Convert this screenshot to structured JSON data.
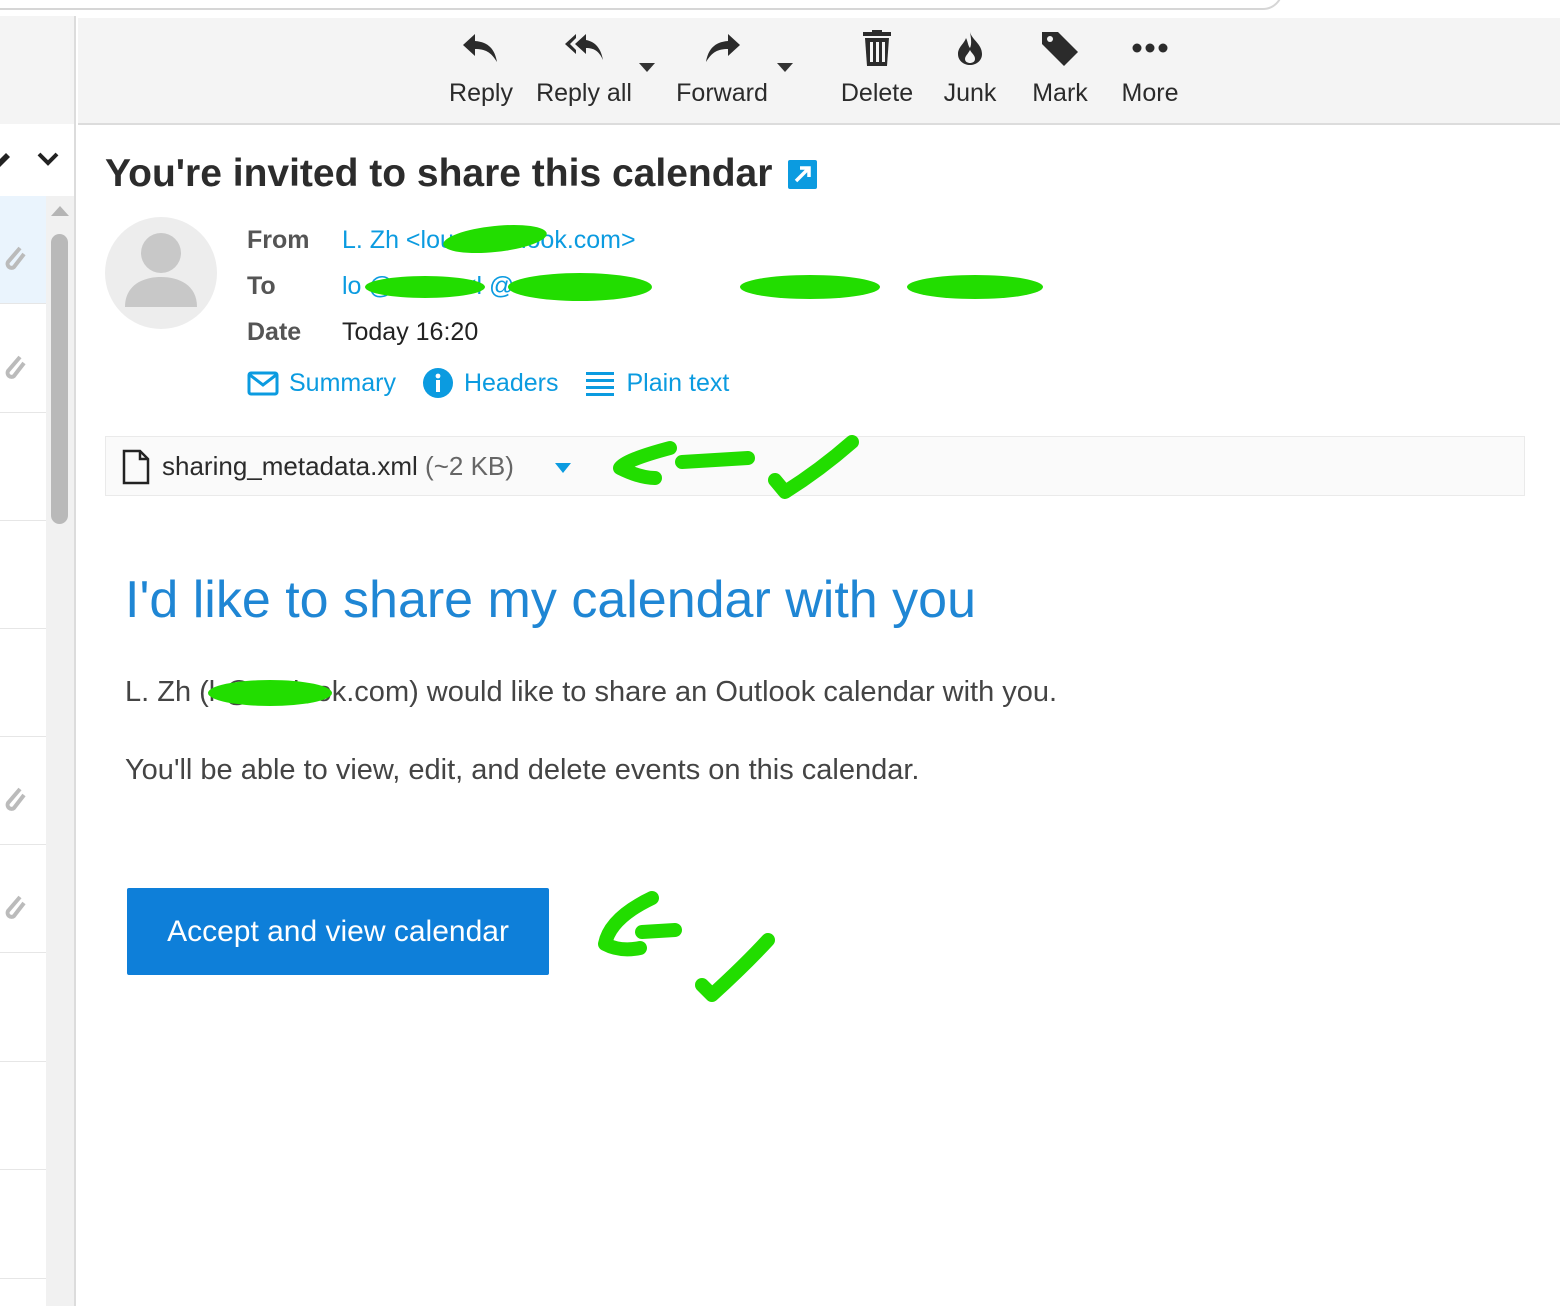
{
  "toolbar": {
    "reply": "Reply",
    "reply_all": "Reply all",
    "forward": "Forward",
    "delete": "Delete",
    "junk": "Junk",
    "mark": "Mark",
    "more": "More"
  },
  "message": {
    "subject": "You're invited to share this calendar",
    "from_label": "From",
    "from_value": "L. Zh <lou        @outlook.com>",
    "to_label": "To",
    "to_value": "lo         @             .com <l              @                .com>",
    "date_label": "Date",
    "date_value": "Today 16:20",
    "links": {
      "summary": "Summary",
      "headers": "Headers",
      "plain_text": "Plain text"
    }
  },
  "attachment": {
    "filename": "sharing_metadata.xml",
    "size": "(~2 KB)"
  },
  "body": {
    "title": "I'd like to share my calendar with you",
    "line1": "L. Zh (l         @outlook.com) would like to share an Outlook calendar with you.",
    "line2": "You'll be able to view, edit, and delete events on this calendar.",
    "accept_button": "Accept and view calendar"
  },
  "colors": {
    "link": "#0b9be0",
    "accent_button": "#0e7fd9",
    "annotation_green": "#22dd00"
  }
}
